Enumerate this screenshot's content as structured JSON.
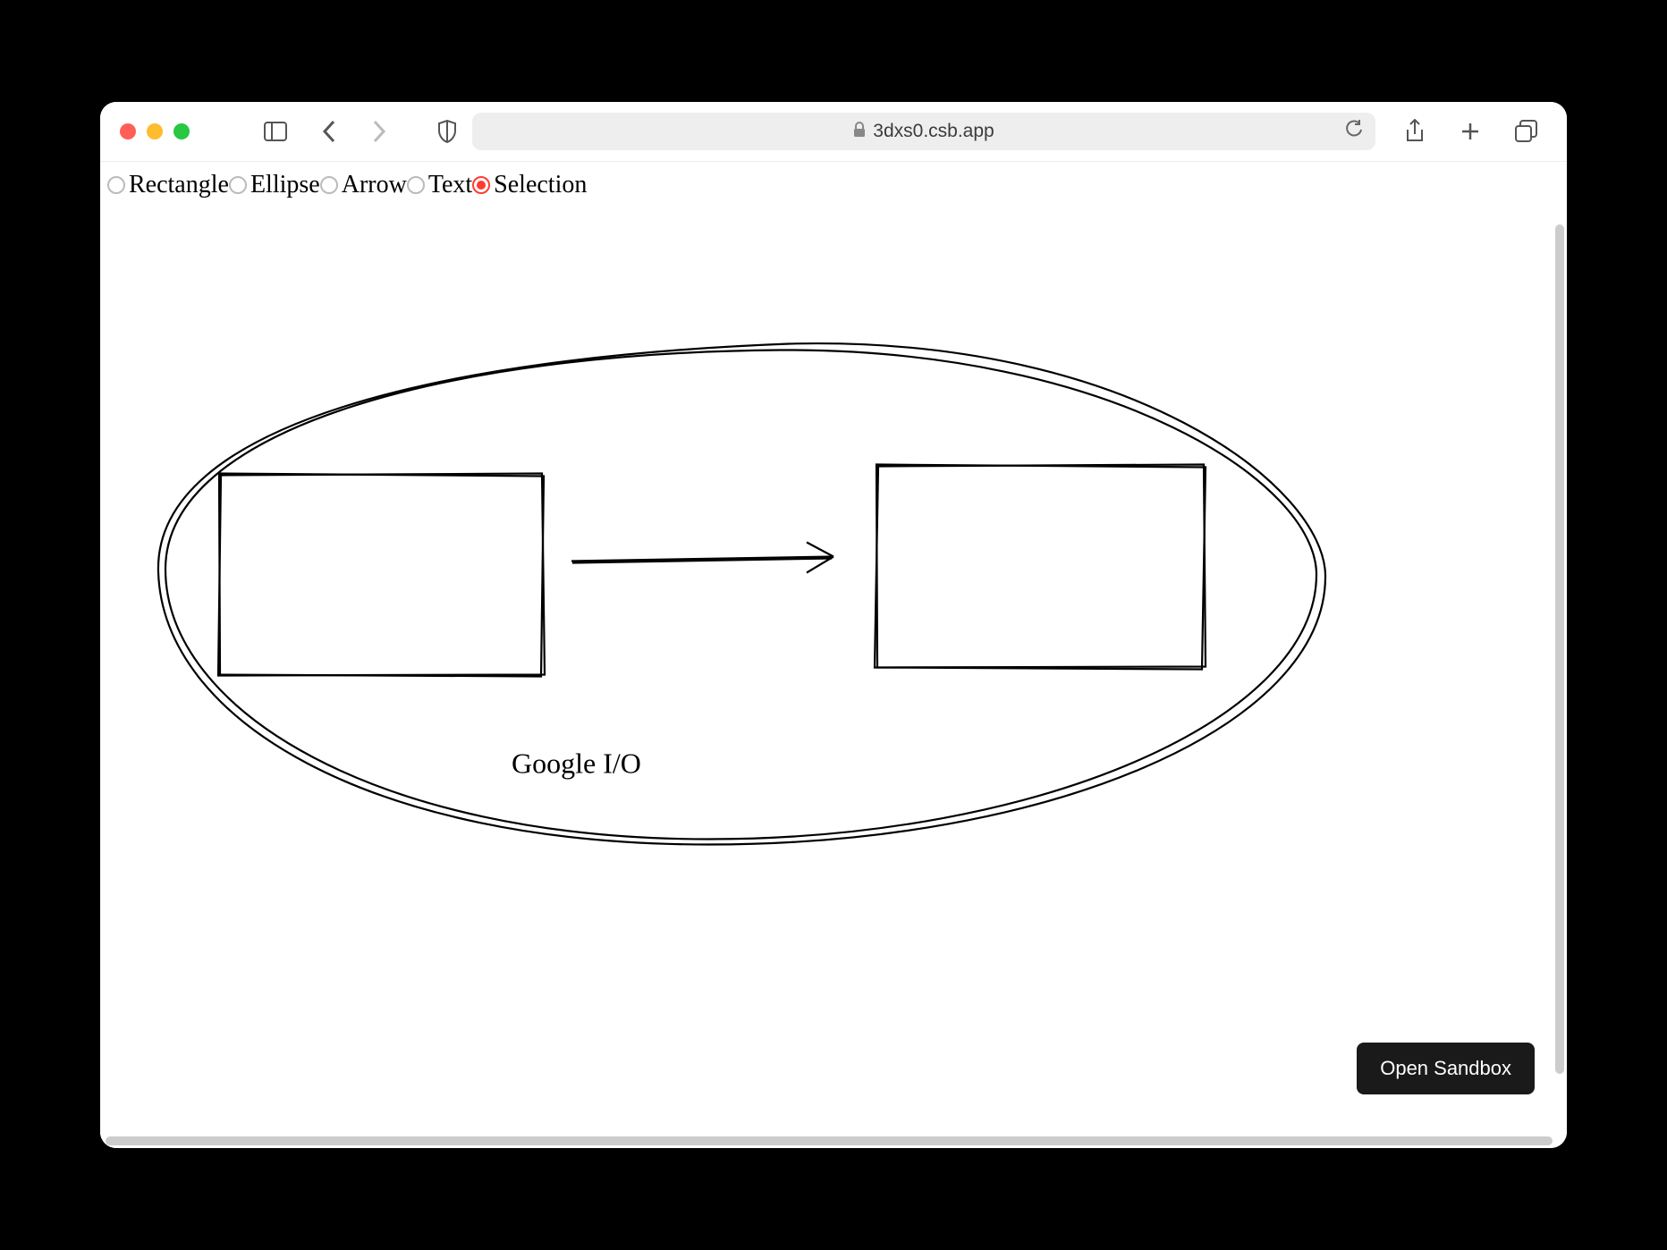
{
  "browser": {
    "url": "3dxs0.csb.app"
  },
  "toolbar": {
    "tools": [
      {
        "name": "rectangle",
        "label": "Rectangle",
        "selected": false
      },
      {
        "name": "ellipse",
        "label": "Ellipse",
        "selected": false
      },
      {
        "name": "arrow",
        "label": "Arrow",
        "selected": false
      },
      {
        "name": "text",
        "label": "Text",
        "selected": false
      },
      {
        "name": "selection",
        "label": "Selection",
        "selected": true
      }
    ]
  },
  "canvas": {
    "text_label": "Google I/O"
  },
  "buttons": {
    "open_sandbox": "Open Sandbox"
  }
}
